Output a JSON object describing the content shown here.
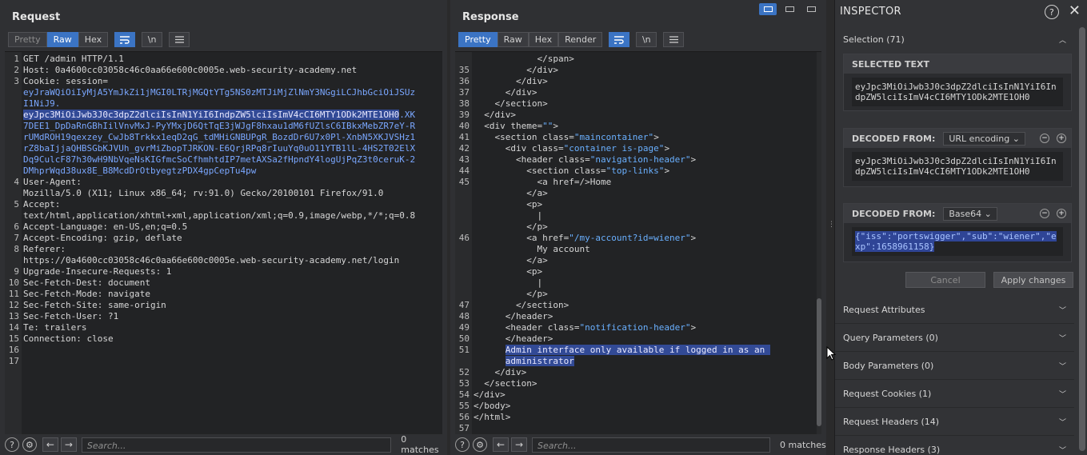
{
  "request": {
    "title": "Request",
    "tabs": [
      "Pretty",
      "Raw",
      "Hex"
    ],
    "active_tab": "Raw",
    "icons": [
      "wrap-icon",
      "newline-icon",
      "menu-icon"
    ],
    "newline_label": "\\n",
    "lines": [
      {
        "n": "1",
        "t": "GET /admin HTTP/1.1"
      },
      {
        "n": "2",
        "t": "Host: 0a4600cc03058c46c0aa66e600c0005e.web-security-academy.net"
      },
      {
        "n": "3",
        "t": "Cookie: session="
      },
      {
        "n": "",
        "t": "eyJraWQiOiIyMjA5YmJkZi1jMGI0LTRjMGQtYTg5NS0zMTJiMjZlNmY3NGgiLCJhbGciOiJSUzI1NiJ9."
      },
      {
        "n": "",
        "t": "eyJpc3MiOiJwb3J0c3dpZ2dlciIsInN1YiI6IndpZW5lciIsImV4cCI6MTY1ODk2MTE1OH0.XK7DEE1_DpDaRnGBhIilVnvMxJ-PyYMxjD6QtTqE3jWJgF8hxau1dM6fUZlsC6IBkxMebZR7eY-RrUMdROH19qexzey_CwJb8Trkkx1eqD2qG_tdMHiGNBUPgR_BozdDr6U7x0Pl-XnbN5XKJVSHz1rZ8baIjjaQHBSGbKJVUh_gvrMiZbopTJRKON-E6QrjRPq8rIuuYq0uO11YTB1lL-4HS2T02ElXDq9CulcF87h30wH9NbVqeNsKIGfmcSoCfhmhtdIP7metAXSa2fHpndY4logUjPqZ3t0ceruK-2DMhprWqd38ux8E_B8McdDrOtbyegtzPDX4gpCepTu4pw"
      },
      {
        "n": "4",
        "t": "User-Agent: Mozilla/5.0 (X11; Linux x86_64; rv:91.0) Gecko/20100101 Firefox/91.0"
      },
      {
        "n": "5",
        "t": "Accept: text/html,application/xhtml+xml,application/xml;q=0.9,image/webp,*/*;q=0.8"
      },
      {
        "n": "6",
        "t": "Accept-Language: en-US,en;q=0.5"
      },
      {
        "n": "7",
        "t": "Accept-Encoding: gzip, deflate"
      },
      {
        "n": "8",
        "t": "Referer: https://0a4600cc03058c46c0aa66e600c0005e.web-security-academy.net/login"
      },
      {
        "n": "9",
        "t": "Upgrade-Insecure-Requests: 1"
      },
      {
        "n": "10",
        "t": "Sec-Fetch-Dest: document"
      },
      {
        "n": "11",
        "t": "Sec-Fetch-Mode: navigate"
      },
      {
        "n": "12",
        "t": "Sec-Fetch-Site: same-origin"
      },
      {
        "n": "13",
        "t": "Sec-Fetch-User: ?1"
      },
      {
        "n": "14",
        "t": "Te: trailers"
      },
      {
        "n": "15",
        "t": "Connection: close"
      },
      {
        "n": "16",
        "t": ""
      },
      {
        "n": "17",
        "t": ""
      }
    ],
    "search_placeholder": "Search...",
    "matches": "0 matches"
  },
  "response": {
    "title": "Response",
    "tabs": [
      "Pretty",
      "Raw",
      "Hex",
      "Render"
    ],
    "active_tab": "Pretty",
    "newline_label": "\\n",
    "lines": [
      {
        "n": "",
        "t": "            </span>"
      },
      {
        "n": "35",
        "t": "          </div>"
      },
      {
        "n": "36",
        "t": "        </div>"
      },
      {
        "n": "37",
        "t": "      </div>"
      },
      {
        "n": "38",
        "t": "    </section>"
      },
      {
        "n": "39",
        "t": "  </div>"
      },
      {
        "n": "40",
        "t": "  <div theme=\"\">"
      },
      {
        "n": "41",
        "t": "    <section class=\"maincontainer\">"
      },
      {
        "n": "42",
        "t": "      <div class=\"container is-page\">"
      },
      {
        "n": "43",
        "t": "        <header class=\"navigation-header\">"
      },
      {
        "n": "44",
        "t": "          <section class=\"top-links\">"
      },
      {
        "n": "45",
        "t": "            <a href=/>Home"
      },
      {
        "n": "",
        "t": "          </a>"
      },
      {
        "n": "",
        "t": "          <p>"
      },
      {
        "n": "",
        "t": "            |"
      },
      {
        "n": "",
        "t": "          </p>"
      },
      {
        "n": "46",
        "t": "          <a href=\"/my-account?id=wiener\">"
      },
      {
        "n": "",
        "t": "            My account"
      },
      {
        "n": "",
        "t": "          </a>"
      },
      {
        "n": "",
        "t": "          <p>"
      },
      {
        "n": "",
        "t": "            |"
      },
      {
        "n": "",
        "t": "          </p>"
      },
      {
        "n": "47",
        "t": "        </section>"
      },
      {
        "n": "48",
        "t": "      </header>"
      },
      {
        "n": "49",
        "t": "      <header class=\"notification-header\">"
      },
      {
        "n": "50",
        "t": "      </header>"
      },
      {
        "n": "51",
        "t": "      Admin interface only available if logged in as an"
      },
      {
        "n": "",
        "t": "      administrator"
      },
      {
        "n": "52",
        "t": "    </div>"
      },
      {
        "n": "53",
        "t": "  </section>"
      },
      {
        "n": "54",
        "t": "</div>"
      },
      {
        "n": "55",
        "t": "</body>"
      },
      {
        "n": "56",
        "t": "</html>"
      },
      {
        "n": "57",
        "t": ""
      }
    ],
    "search_placeholder": "Search...",
    "matches": "0 matches"
  },
  "inspector": {
    "title": "INSPECTOR",
    "help_label": "?",
    "close_label": "✕",
    "selection_label": "Selection (71)",
    "selected_text_label": "SELECTED TEXT",
    "selected_text": "eyJpc3MiOiJwb3J0c3dpZ2dlciIsInN1YiI6IndpZW5lciIsImV4cCI6MTY1ODk2MTE1OH0",
    "decoded_1_label": "DECODED FROM:",
    "decoded_1_option": "URL encoding",
    "decoded_1_text": "eyJpc3MiOiJwb3J0c3dpZ2dlciIsInN1YiI6IndpZW5lciIsImV4cCI6MTY1ODk2MTE1OH0",
    "decoded_2_label": "DECODED FROM:",
    "decoded_2_option": "Base64",
    "decoded_2_text": "{\"iss\":\"portswigger\",\"sub\":\"wiener\",\"exp\":1658961158}",
    "cancel_label": "Cancel",
    "apply_label": "Apply changes",
    "sections": [
      "Request Attributes",
      "Query Parameters (0)",
      "Body Parameters (0)",
      "Request Cookies (1)",
      "Request Headers (14)",
      "Response Headers (3)"
    ]
  },
  "colors": {
    "accent": "#3b74c4",
    "selection": "#324a96",
    "value": "#6ab0ff"
  }
}
